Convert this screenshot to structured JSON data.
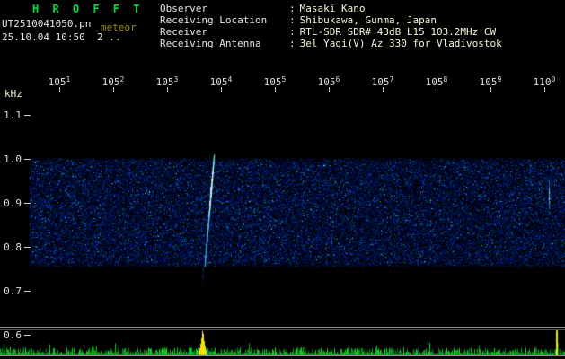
{
  "header": {
    "app_title": "H R O F F T",
    "filename": "UT2510041050.pn",
    "overlay_tag": "meteor",
    "date_line": "25.10.04 10:50  2 .."
  },
  "info_table": {
    "separator": ":",
    "rows": [
      {
        "label": "Observer",
        "value": "Masaki Kano"
      },
      {
        "label": "Receiving Location",
        "value": "Shibukawa, Gunma, Japan"
      },
      {
        "label": "Receiver",
        "value": "RTL-SDR SDR# 43dB L15 103.2MHz CW"
      },
      {
        "label": "Receiving Antenna",
        "value": "3el Yagi(V) Az 330 for Vladivostok"
      }
    ]
  },
  "chart_data": {
    "type": "heatmap",
    "subtype": "radio-meteor-spectrogram",
    "y_unit": "kHz",
    "y_ticks": [
      "1.1",
      "1.0",
      "0.9",
      "0.8",
      "0.7",
      "0.6"
    ],
    "x_ticks": [
      "1051",
      "1052",
      "1053",
      "1054",
      "1055",
      "1056",
      "1057",
      "1058",
      "1059",
      "1100"
    ],
    "x_range_ut": [
      "10:50",
      "11:00"
    ],
    "noise_band_khz": [
      0.75,
      1.0
    ],
    "events": [
      {
        "name": "meteor-echo-streak",
        "time_ut": "10:53.7",
        "khz_from": 1.0,
        "khz_to": 0.75
      },
      {
        "name": "power-spike",
        "time_ut": "10:53.7"
      },
      {
        "name": "edge-echo",
        "time_ut": "11:00",
        "khz_from": 0.95,
        "khz_to": 0.86
      }
    ]
  },
  "colors": {
    "title_green": "#00dd44",
    "overlay_olive": "#9a8a10",
    "text_white": "#e6e6e6",
    "value_tint": "#f6f6da",
    "axis_text": "#dcdcdc",
    "unit_tint": "#eeeecd",
    "noise_blue": "#0018a0",
    "echo_cyan": "#aaffff",
    "power_green": "#00c828",
    "marker_yellow": "#f5e400",
    "line_gray": "#909090"
  }
}
